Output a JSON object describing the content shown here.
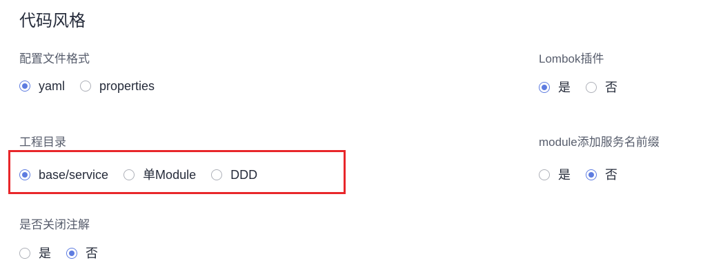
{
  "section_title": "代码风格",
  "config_format": {
    "label": "配置文件格式",
    "options": [
      {
        "label": "yaml",
        "checked": true
      },
      {
        "label": "properties",
        "checked": false
      }
    ]
  },
  "project_dir": {
    "label": "工程目录",
    "options": [
      {
        "label": "base/service",
        "checked": true
      },
      {
        "label": "单Module",
        "checked": false
      },
      {
        "label": "DDD",
        "checked": false
      }
    ]
  },
  "close_annotation": {
    "label": "是否关闭注解",
    "options": [
      {
        "label": "是",
        "checked": false
      },
      {
        "label": "否",
        "checked": true
      }
    ]
  },
  "lombok": {
    "label": "Lombok插件",
    "options": [
      {
        "label": "是",
        "checked": true
      },
      {
        "label": "否",
        "checked": false
      }
    ]
  },
  "module_prefix": {
    "label": "module添加服务名前缀",
    "options": [
      {
        "label": "是",
        "checked": false
      },
      {
        "label": "否",
        "checked": true
      }
    ]
  },
  "colors": {
    "accent": "#5e7ce0",
    "highlight": "#e8262a"
  }
}
